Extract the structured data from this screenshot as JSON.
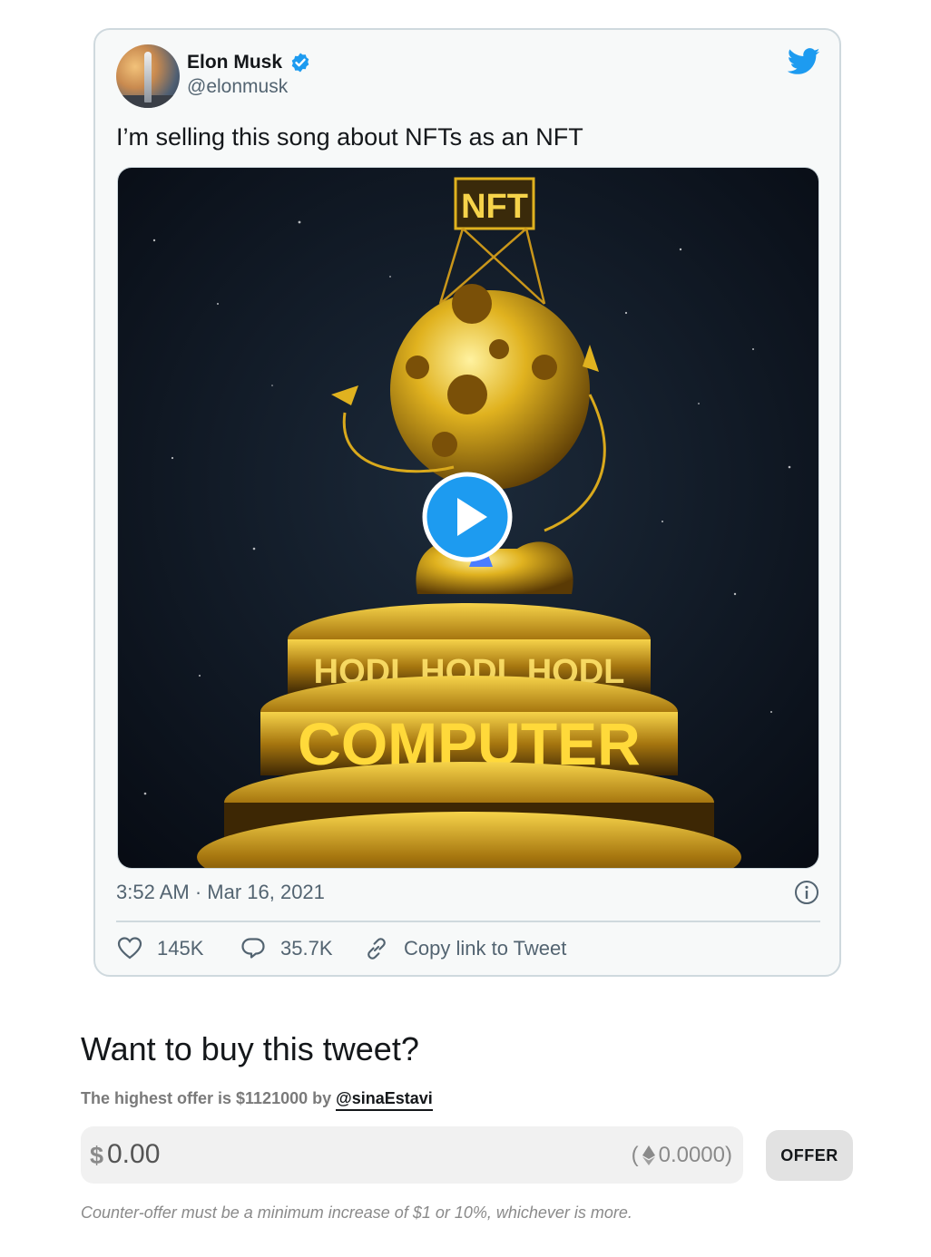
{
  "tweet": {
    "author_name": "Elon Musk",
    "author_handle": "@elonmusk",
    "text": "I’m selling this song about NFTs as an NFT",
    "media_sign_text": "NFT",
    "media_text_hodl": "HODL HODL HODL",
    "media_text_computer": "COMPUTER",
    "timestamp": "3:52 AM · Mar 16, 2021",
    "likes": "145K",
    "replies": "35.7K",
    "copy_link_label": "Copy link to Tweet"
  },
  "purchase": {
    "heading": "Want to buy this tweet?",
    "offer_prefix": "The highest offer is $1121000 by",
    "offer_user": "@sinaEstavi",
    "currency_symbol": "$",
    "amount_placeholder": "0.00",
    "eth_open": "(",
    "eth_value": "0.0000)",
    "offer_button_label": "OFFER",
    "min_note": "Counter-offer must be a minimum increase of $1 or 10%, whichever is more."
  },
  "colors": {
    "twitter_blue": "#1d9bf0",
    "card_background": "#f7f9f9",
    "border": "#cfd9de",
    "muted_text": "#536471"
  },
  "icons": {
    "verified": "verified-badge-icon",
    "logo": "twitter-bird-icon",
    "play": "play-icon",
    "info": "info-icon",
    "like": "heart-icon",
    "reply": "speech-bubble-icon",
    "copy": "link-icon",
    "eth": "ethereum-icon"
  }
}
